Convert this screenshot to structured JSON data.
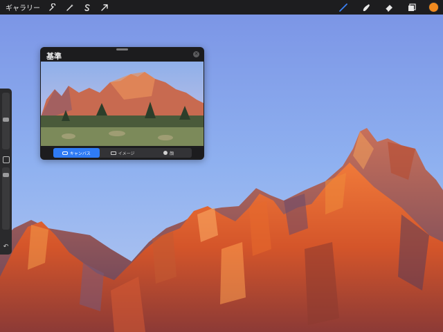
{
  "toolbar": {
    "gallery_label": "ギャラリー",
    "left_icons": [
      "wrench-icon",
      "magic-wand-icon",
      "selection-s-icon",
      "transform-arrow-icon"
    ],
    "right_icons": [
      "brush-icon",
      "smudge-icon",
      "eraser-icon",
      "layers-icon"
    ],
    "active_color": "#f08a1f"
  },
  "reference_panel": {
    "title": "基準",
    "tabs": [
      {
        "label": "キャンバス",
        "icon": "canvas-icon",
        "active": true
      },
      {
        "label": "イメージ",
        "icon": "image-icon",
        "active": false
      },
      {
        "label": "顔",
        "icon": "face-icon",
        "active": false
      }
    ]
  },
  "colors": {
    "sky_top": "#7d98e6",
    "sky_bottom": "#a9c4f2",
    "rock_orange": "#e0622e",
    "accent_blue": "#2f7bf5"
  }
}
